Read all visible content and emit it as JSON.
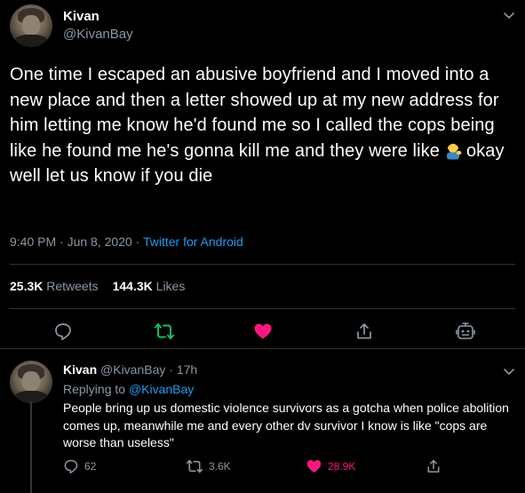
{
  "main_tweet": {
    "display_name": "Kivan",
    "handle": "@KivanBay",
    "text_part1": "One time I escaped an abusive boyfriend and I moved into a new place and then a letter showed up at my new address for him letting me know he'd found me so I called the cops being like he found me he's gonna kill me and they were like",
    "emoji": "man-tipping-hand-emoji",
    "text_part2": "okay well let us know if you die",
    "time": "9:40 PM",
    "sep1": " · ",
    "date": "Jun 8, 2020",
    "sep2": " · ",
    "source": "Twitter for Android",
    "retweets_count": "25.3K",
    "retweets_label": "Retweets",
    "likes_count": "144.3K",
    "likes_label": "Likes",
    "icons": [
      "chevron-down-icon",
      "reply-icon",
      "retweet-icon",
      "like-icon",
      "share-icon",
      "analytics-icon"
    ],
    "colors": {
      "retweet": "#17bf63",
      "like": "#f91880",
      "link": "#1d9bf0"
    }
  },
  "reply_tweet": {
    "display_name": "Kivan",
    "handle": "@KivanBay",
    "sep": " · ",
    "time_ago": "17h",
    "replying_label": "Replying to ",
    "replying_to": "@KivanBay",
    "text": "People bring up us domestic violence survivors as a gotcha when police abolition comes up, meanwhile me and every other dv survivor I know is like \"cops are worse than useless\"",
    "replies_count": "62",
    "retweets_count": "3.6K",
    "likes_count": "28.9K",
    "icons": [
      "chevron-down-icon",
      "reply-icon",
      "retweet-icon",
      "like-icon",
      "share-icon"
    ]
  }
}
